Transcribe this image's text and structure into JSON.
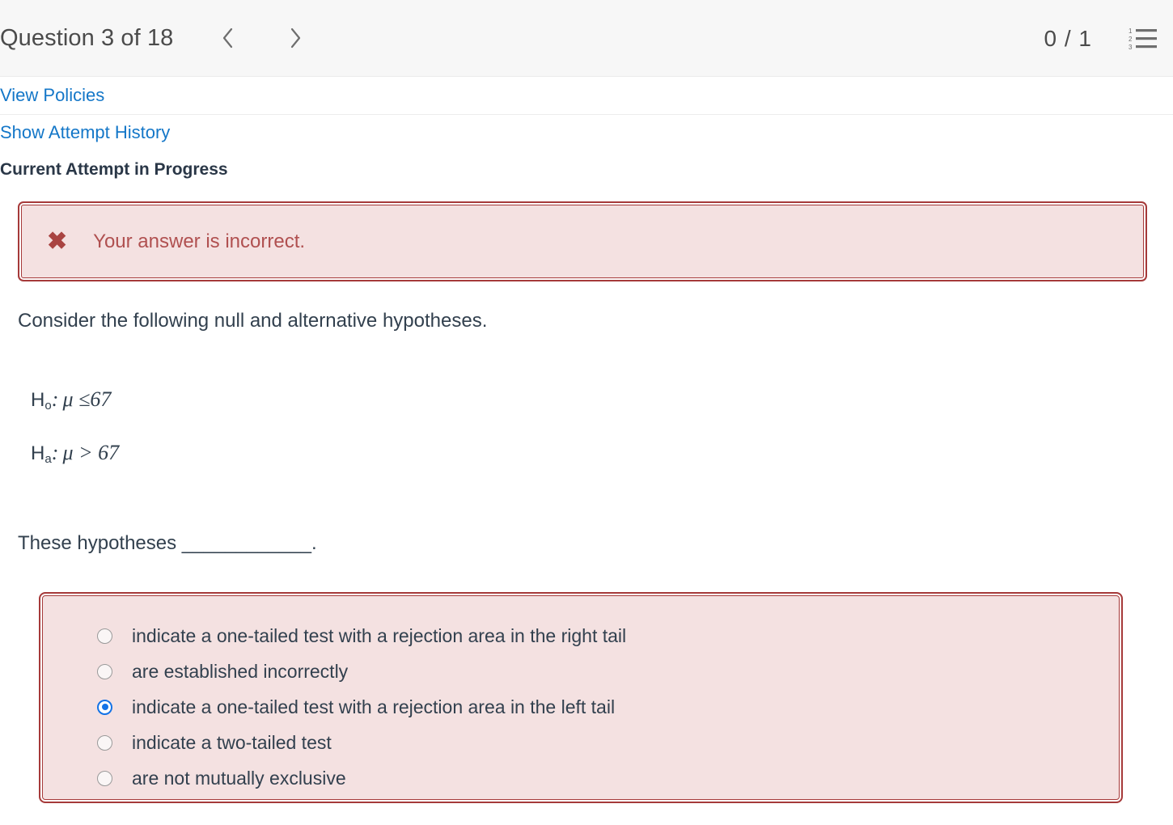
{
  "header": {
    "question_title": "Question 3 of 18",
    "prev_icon": "chevron-left-icon",
    "next_icon": "chevron-right-icon",
    "score": "0 / 1",
    "list_icon": "numbered-list-icon"
  },
  "links": {
    "view_policies": "View Policies",
    "show_attempt_history": "Show Attempt History",
    "current_attempt": "Current Attempt in Progress"
  },
  "alert": {
    "icon": "x-mark-icon",
    "icon_glyph": "✖",
    "message": "Your answer is incorrect.",
    "background": "#f4e1e1",
    "border_color": "#a63a3a",
    "text_color": "#b05050"
  },
  "question": {
    "prompt": "Consider the following null and alternative hypotheses.",
    "hypothesis_null_label": "H",
    "hypothesis_null_sub": "o",
    "hypothesis_null_body": ": μ ≤67",
    "hypothesis_alt_label": "H",
    "hypothesis_alt_sub": "a",
    "hypothesis_alt_body": ": μ > 67",
    "blank_statement": "These hypotheses ____________."
  },
  "options": {
    "accent_selected": "#1473e6",
    "items": [
      {
        "label": "indicate a one-tailed test with a rejection area in the right tail",
        "selected": false
      },
      {
        "label": "are established incorrectly",
        "selected": false
      },
      {
        "label": "indicate a one-tailed test with a rejection area in the left tail",
        "selected": true
      },
      {
        "label": "indicate a two-tailed test",
        "selected": false
      },
      {
        "label": "are not mutually exclusive",
        "selected": false
      }
    ]
  }
}
